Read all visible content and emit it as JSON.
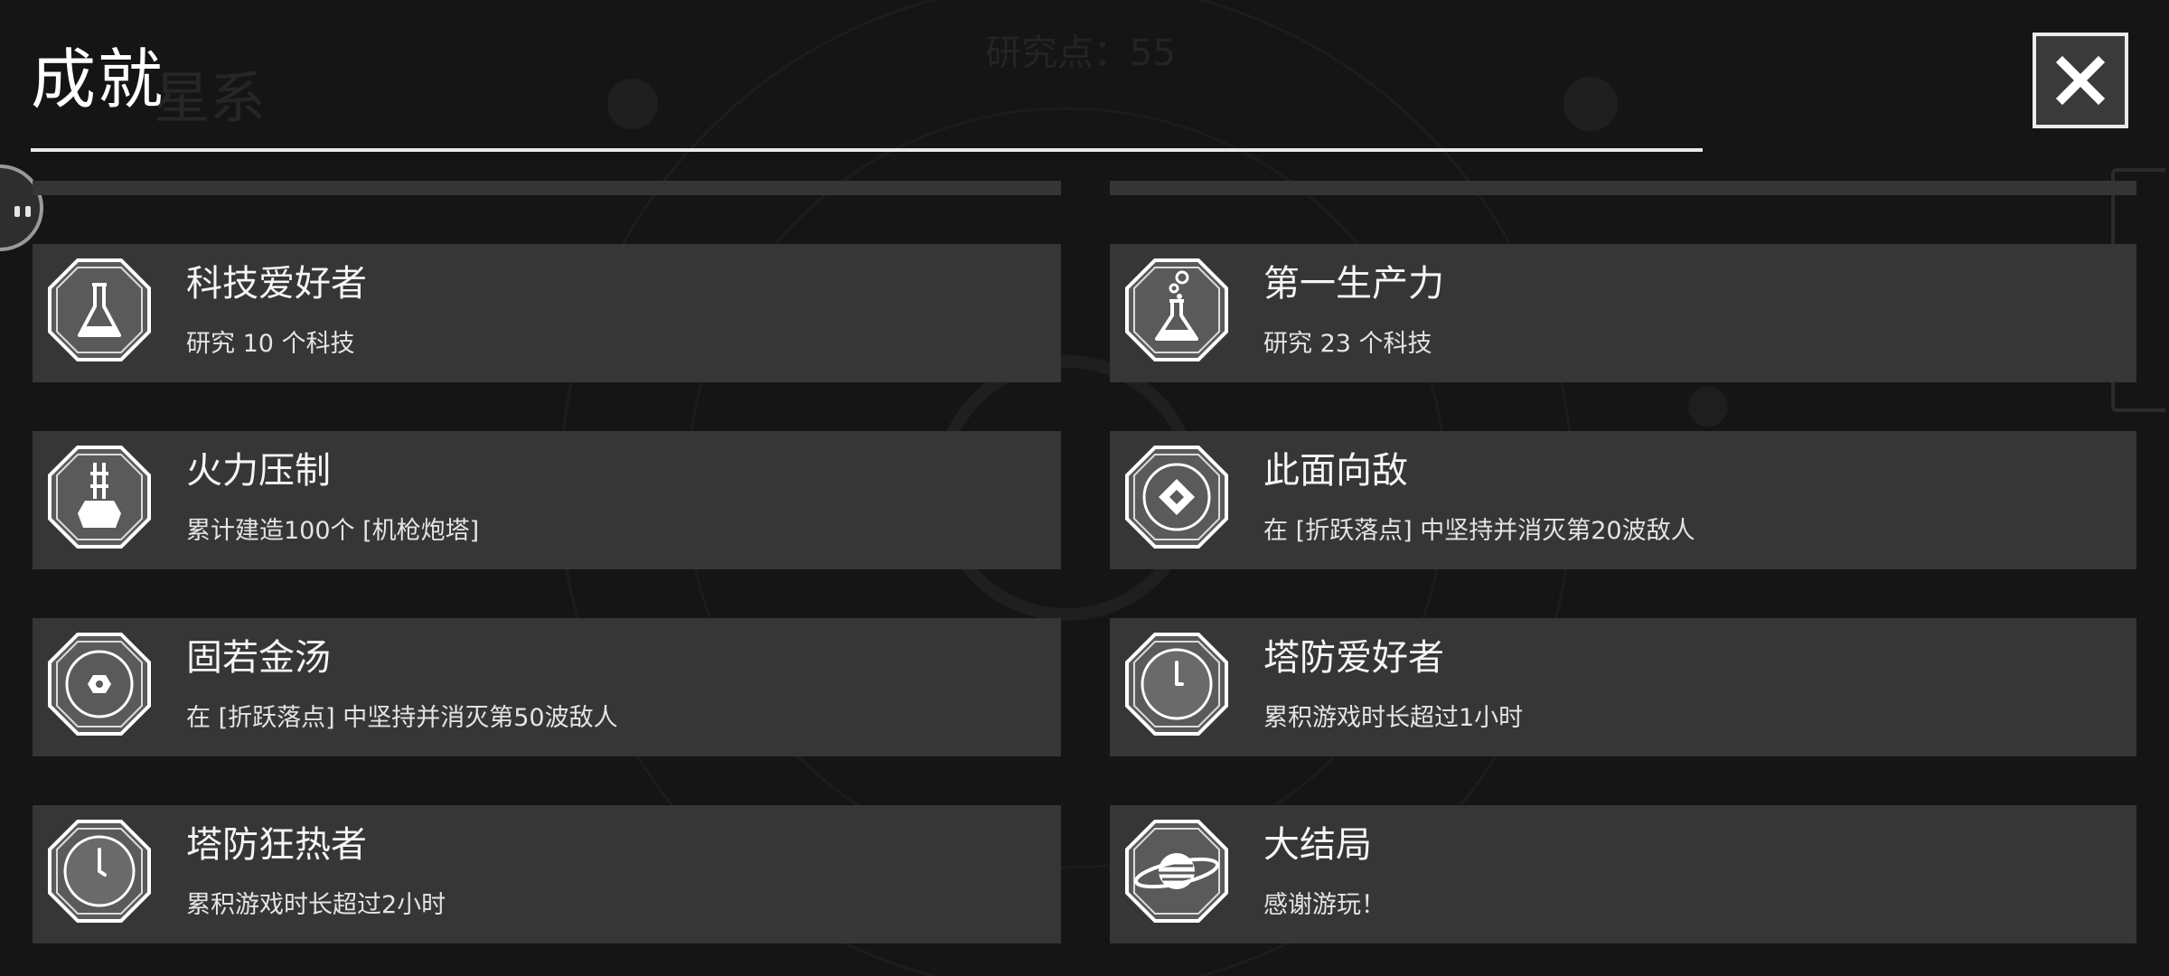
{
  "header": {
    "title": "成就",
    "close_label": "✕"
  },
  "background": {
    "ghost_title": "星系",
    "ghost_points": "研究点：55"
  },
  "achievements": [
    {
      "title": "科技爱好者",
      "description": "研究 10 个科技",
      "icon": "flask-icon"
    },
    {
      "title": "第一生产力",
      "description": "研究 23 个科技",
      "icon": "bubbling-flask-icon"
    },
    {
      "title": "火力压制",
      "description": "累计建造100个 [机枪炮塔]",
      "icon": "machine-gun-turret-icon"
    },
    {
      "title": "此面向敌",
      "description": "在 [折跃落点] 中坚持并消灭第20波敌人",
      "icon": "diamond-target-icon"
    },
    {
      "title": "固若金汤",
      "description": "在 [折跃落点] 中坚持并消灭第50波敌人",
      "icon": "fortress-ring-icon"
    },
    {
      "title": "塔防爱好者",
      "description": "累积游戏时长超过1小时",
      "icon": "clock-icon"
    },
    {
      "title": "塔防狂热者",
      "description": "累积游戏时长超过2小时",
      "icon": "clock-icon"
    },
    {
      "title": "大结局",
      "description": "感谢游玩！",
      "icon": "planet-icon"
    }
  ],
  "colors": {
    "background": "#151515",
    "card": "#363636",
    "badge_fill": "#5a5a5a",
    "badge_stroke": "#ffffff"
  }
}
